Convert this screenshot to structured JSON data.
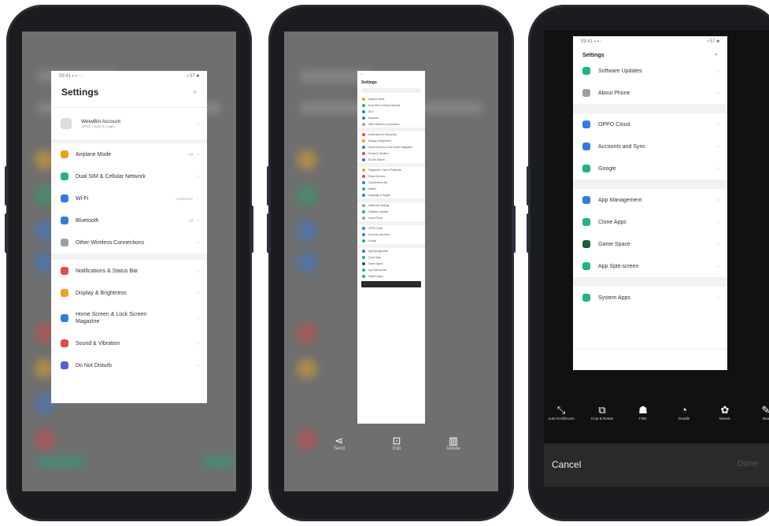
{
  "colors": {
    "accent": "#1ab394",
    "phone_body": "#1b1c20"
  },
  "phone1": {
    "status_left": "09:41 ▪ ▪ ◦ ◦",
    "status_right": "▪ 57 ■",
    "title": "Settings",
    "search_icon": "search-icon",
    "account": {
      "name": "WeiwBin Account",
      "sub": "UPSS • Sign-in Login"
    },
    "rows": [
      {
        "label": "Airplane Mode",
        "color": "#f2a01c",
        "icon": "airplane-icon",
        "value": "Off"
      },
      {
        "label": "Dual SIM & Cellular Network",
        "color": "#21b57a",
        "icon": "sim-icon",
        "value": ""
      },
      {
        "label": "Wi-Fi",
        "color": "#2f7ae5",
        "icon": "wifi-icon",
        "value": "AndroidAP"
      },
      {
        "label": "Bluetooth",
        "color": "#2f7ae5",
        "icon": "bluetooth-icon",
        "value": "Off"
      },
      {
        "label": "Other Wireless Connections",
        "color": "#9aa0a6",
        "icon": "wireless-icon",
        "value": ""
      },
      {
        "label": "Notifications & Status Bar",
        "color": "#e5484d",
        "icon": "notification-icon",
        "value": ""
      },
      {
        "label": "Display & Brightness",
        "color": "#f2a01c",
        "icon": "display-icon",
        "value": ""
      },
      {
        "label": "Home Screen & Lock Screen Magazine",
        "color": "#2f7ae5",
        "icon": "home-screen-icon",
        "value": ""
      },
      {
        "label": "Sound & Vibration",
        "color": "#e5484d",
        "icon": "sound-icon",
        "value": ""
      },
      {
        "label": "Do Not Disturb",
        "color": "#5b5bd6",
        "icon": "moon-icon",
        "value": ""
      }
    ]
  },
  "phone2": {
    "title": "Settings",
    "mini_rows": [
      "Airplane Mode",
      "Dual SIM & Cellular Network",
      "Wi-Fi",
      "Bluetooth",
      "Other Wireless Connections",
      "Notifications & Status Bar",
      "Display & Brightness",
      "Home Screen & Lock Screen Magazine",
      "Sound & Vibration",
      "Do Not Disturb",
      "Fingerprint, Face & Passcode",
      "Smart Services",
      "Convenience Aid",
      "Battery",
      "Language & Region",
      "Additional Settings",
      "Software Updates",
      "About Phone",
      "OPPO Cloud",
      "Accounts and Sync",
      "Google",
      "App Management",
      "Clone Apps",
      "Game Space",
      "App Split-screen",
      "System Apps"
    ],
    "actions": [
      {
        "label": "Send",
        "icon": "share-icon"
      },
      {
        "label": "Edit",
        "icon": "edit-icon"
      },
      {
        "label": "Delete",
        "icon": "trash-icon"
      }
    ]
  },
  "phone3": {
    "status_left": "09:41 ▪ ▪ ◦",
    "status_right": "▪ 57 ■",
    "title": "Settings",
    "rows": [
      {
        "label": "Software Updates",
        "color": "#21b57a",
        "icon": "update-icon"
      },
      {
        "label": "About Phone",
        "color": "#9aa0a6",
        "icon": "phone-info-icon"
      },
      {
        "label": "OPPO Cloud",
        "color": "#2f7ae5",
        "icon": "cloud-icon"
      },
      {
        "label": "Accounts and Sync",
        "color": "#2f7ae5",
        "icon": "account-sync-icon"
      },
      {
        "label": "Google",
        "color": "#21b57a",
        "icon": "google-icon"
      },
      {
        "label": "App Management",
        "color": "#2f7ae5",
        "icon": "apps-icon"
      },
      {
        "label": "Clone Apps",
        "color": "#21b57a",
        "icon": "clone-icon"
      },
      {
        "label": "Game Space",
        "color": "#1c5f3a",
        "icon": "game-icon"
      },
      {
        "label": "App Split-screen",
        "color": "#21b57a",
        "icon": "split-screen-icon"
      },
      {
        "label": "System Apps",
        "color": "#21b57a",
        "icon": "system-apps-icon"
      }
    ],
    "tools": [
      {
        "label": "Auto-scroll/zoom",
        "glyph": "⤡",
        "icon": "select-icon"
      },
      {
        "label": "Crop & Rotate",
        "glyph": "⧉",
        "icon": "crop-icon"
      },
      {
        "label": "Filter",
        "glyph": "☗",
        "icon": "filter-icon"
      },
      {
        "label": "Doodle",
        "glyph": "◔",
        "icon": "doodle-icon"
      },
      {
        "label": "Mosaic",
        "glyph": "✿",
        "icon": "mosaic-icon"
      },
      {
        "label": "Bea",
        "glyph": "✎",
        "icon": "beauty-icon"
      }
    ],
    "cancel_label": "Cancel",
    "done_label": "Done"
  }
}
